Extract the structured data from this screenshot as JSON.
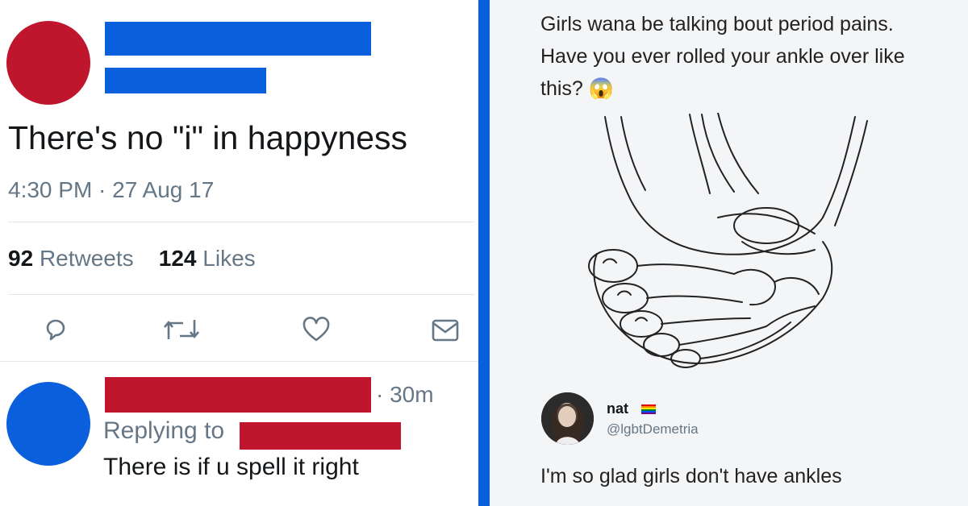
{
  "left_tweet": {
    "text": "There's no \"i\" in happyness",
    "timestamp": "4:30 PM · 27 Aug 17",
    "retweets_count": "92",
    "retweets_label": "Retweets",
    "likes_count": "124",
    "likes_label": "Likes",
    "avatar_color": "#c0162d",
    "redaction_color": "#0a5fdc"
  },
  "reply_tweet": {
    "time": "· 30m",
    "replying_label": "Replying to",
    "text": "There is if u spell it right",
    "avatar_color": "#0a5fdc",
    "redaction_color": "#c0162d"
  },
  "action_icons": [
    "reply-icon",
    "retweet-icon",
    "like-icon",
    "message-icon"
  ],
  "right_post": {
    "caption": "Girls wana be talking bout period pains. Have you ever rolled your ankle over like this? 😱",
    "illustration": "foot-skeleton-drawing",
    "reply": {
      "name": "nat",
      "handle": "@lgbtDemetria",
      "text": "I'm so glad girls don't have ankles"
    }
  },
  "divider_color": "#0a5fdc"
}
